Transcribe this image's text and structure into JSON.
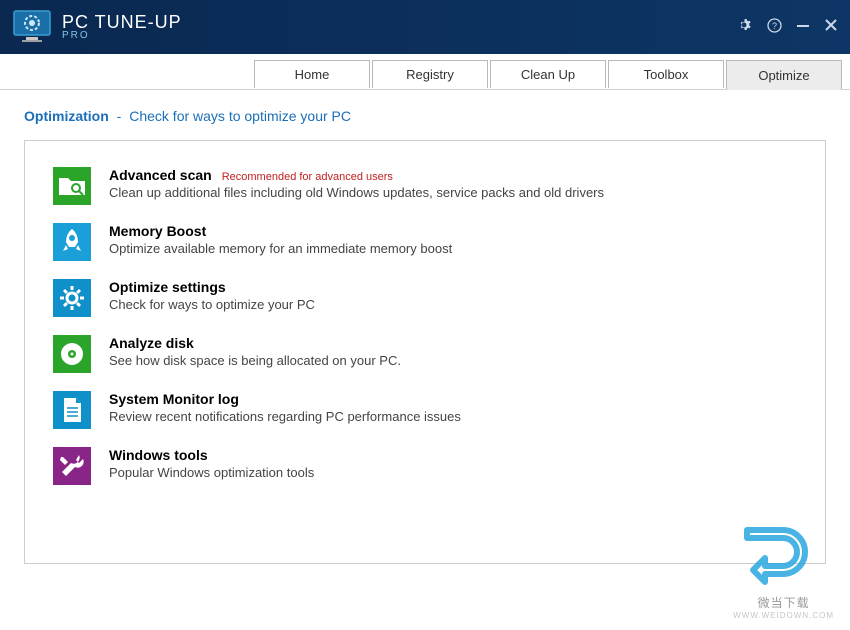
{
  "brand": {
    "title": "PC TUNE-UP",
    "sub": "PRO"
  },
  "tabs": [
    {
      "label": "Home"
    },
    {
      "label": "Registry"
    },
    {
      "label": "Clean Up"
    },
    {
      "label": "Toolbox"
    },
    {
      "label": "Optimize"
    }
  ],
  "subheader": {
    "title": "Optimization",
    "dash": "-",
    "desc": "Check for ways to optimize your PC"
  },
  "items": [
    {
      "title": "Advanced scan",
      "note": "Recommended for advanced users",
      "desc": "Clean up additional files including old Windows updates, service packs and old drivers"
    },
    {
      "title": "Memory Boost",
      "note": "",
      "desc": "Optimize available memory for an immediate memory boost"
    },
    {
      "title": "Optimize settings",
      "note": "",
      "desc": "Check for ways to optimize your PC"
    },
    {
      "title": "Analyze disk",
      "note": "",
      "desc": "See how disk space is being allocated on your PC."
    },
    {
      "title": "System Monitor log",
      "note": "",
      "desc": "Review recent notifications regarding PC performance issues"
    },
    {
      "title": "Windows tools",
      "note": "",
      "desc": "Popular Windows optimization tools"
    }
  ],
  "watermark": {
    "text": "微当下载",
    "sub": "WWW.WEIDOWN.COM"
  },
  "colors": {
    "green": "#2aa52a",
    "blue": "#1a9fd8",
    "blue2": "#1090c8",
    "green2": "#2aa52a",
    "teal": "#1090c8",
    "purple": "#8a2588"
  }
}
